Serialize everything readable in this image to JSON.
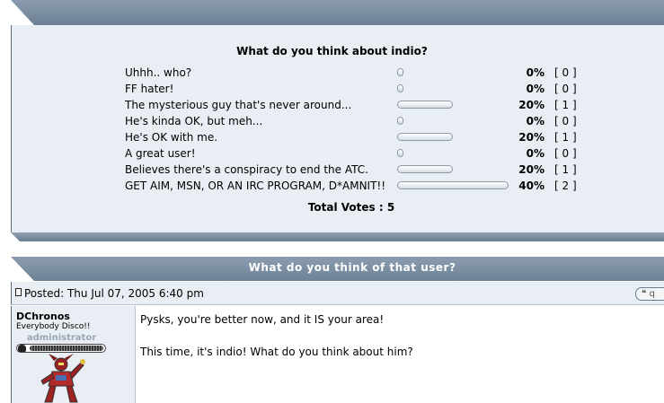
{
  "poll": {
    "question": "What do you think about indio?",
    "options": [
      {
        "label": "Uhhh.. who?",
        "percent_value": 0,
        "percent_text": "0%",
        "count_text": "[ 0 ]"
      },
      {
        "label": "FF hater!",
        "percent_value": 0,
        "percent_text": "0%",
        "count_text": "[ 0 ]"
      },
      {
        "label": "The mysterious guy that's never around...",
        "percent_value": 20,
        "percent_text": "20%",
        "count_text": "[ 1 ]"
      },
      {
        "label": "He's kinda OK, but meh...",
        "percent_value": 0,
        "percent_text": "0%",
        "count_text": "[ 0 ]"
      },
      {
        "label": "He's OK with me.",
        "percent_value": 20,
        "percent_text": "20%",
        "count_text": "[ 1 ]"
      },
      {
        "label": "A great user!",
        "percent_value": 0,
        "percent_text": "0%",
        "count_text": "[ 0 ]"
      },
      {
        "label": "Believes there's a conspiracy to end the ATC.",
        "percent_value": 20,
        "percent_text": "20%",
        "count_text": "[ 1 ]"
      },
      {
        "label": "GET AIM, MSN, OR AN IRC PROGRAM, D*AMNIT!!",
        "percent_value": 40,
        "percent_text": "40%",
        "count_text": "[ 2 ]"
      }
    ],
    "total_votes": "Total Votes : 5"
  },
  "post": {
    "title": "What do you think of that user?",
    "posted": "Posted: Thu Jul 07, 2005 6:40 pm",
    "quote_label": "q",
    "author": {
      "name": "DChronos",
      "subtitle": "Everybody Disco!!",
      "rank": "administrator",
      "rank_level": 1.0
    },
    "message_lines": [
      "Pysks, you're better now, and it IS your area!",
      "This time, it's indio! What do you think about him?"
    ]
  },
  "colors": {
    "header_bar": "#7b8da1",
    "panel_bg": "#e8eef4",
    "border_dark": "#5e6f82"
  }
}
